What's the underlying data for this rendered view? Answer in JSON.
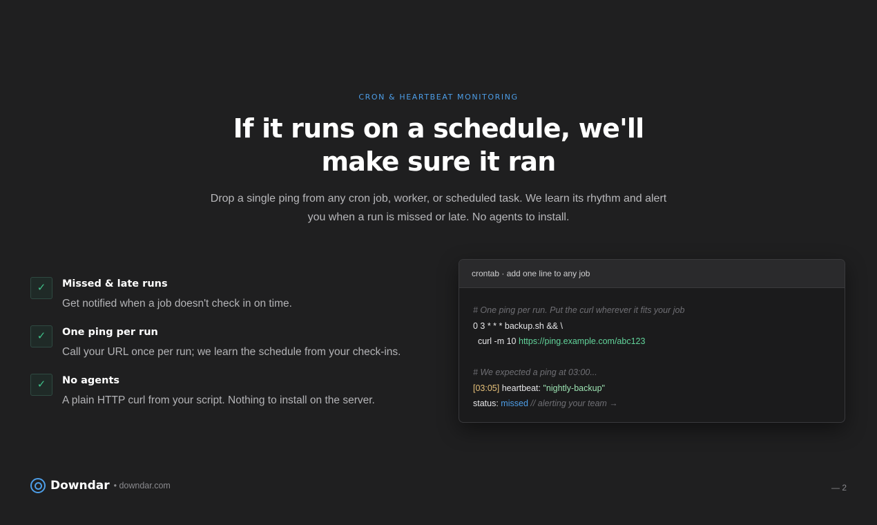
{
  "hero": {
    "eyebrow": "CRON & HEARTBEAT MONITORING",
    "headline_line1": "If it runs on a schedule, we'll",
    "headline_line2": "make sure it ran",
    "subhead_line1": "Drop a single ping from any cron job, worker, or scheduled task. We learn its rhythm and alert",
    "subhead_line2": "you when a run is missed or late. No agents to install."
  },
  "features": [
    {
      "icon": "check-icon",
      "check_glyph": "✓",
      "title": "Missed & late runs",
      "description": "Get notified when a job doesn't check in on time."
    },
    {
      "icon": "check-icon",
      "check_glyph": "✓",
      "title": "One ping per run",
      "description": "Call your URL once per run; we learn the schedule from your check-ins."
    },
    {
      "icon": "check-icon",
      "check_glyph": "✓",
      "title": "No agents",
      "description": "A plain HTTP curl from your script. Nothing to install on the server."
    }
  ],
  "code_card": {
    "header": "crontab · add one line to any job",
    "comment1": "# One ping per run. Put the curl wherever it fits your job",
    "line_cron": "0 3 * * * backup.sh && \\",
    "line_curl_prefix": "  curl -m 10 ",
    "line_curl_url": "https://ping.example.com/abc123",
    "comment2": "# We expected a ping at 03:00...",
    "log_time": "[03:05]",
    "log_label": " heartbeat: ",
    "log_value": "\"nightly-backup\"",
    "status_label": "status: ",
    "status_value": "missed",
    "status_comment": " // alerting your team →"
  },
  "footer": {
    "logo_icon": "radar-icon",
    "brand": "Downdar",
    "domain": "• downdar.com",
    "page_number": "— 2"
  },
  "colors": {
    "background": "#1f1f20",
    "accent_blue": "#4d9ee8",
    "accent_green": "#3fc28a",
    "time_yellow": "#e8c27a"
  }
}
